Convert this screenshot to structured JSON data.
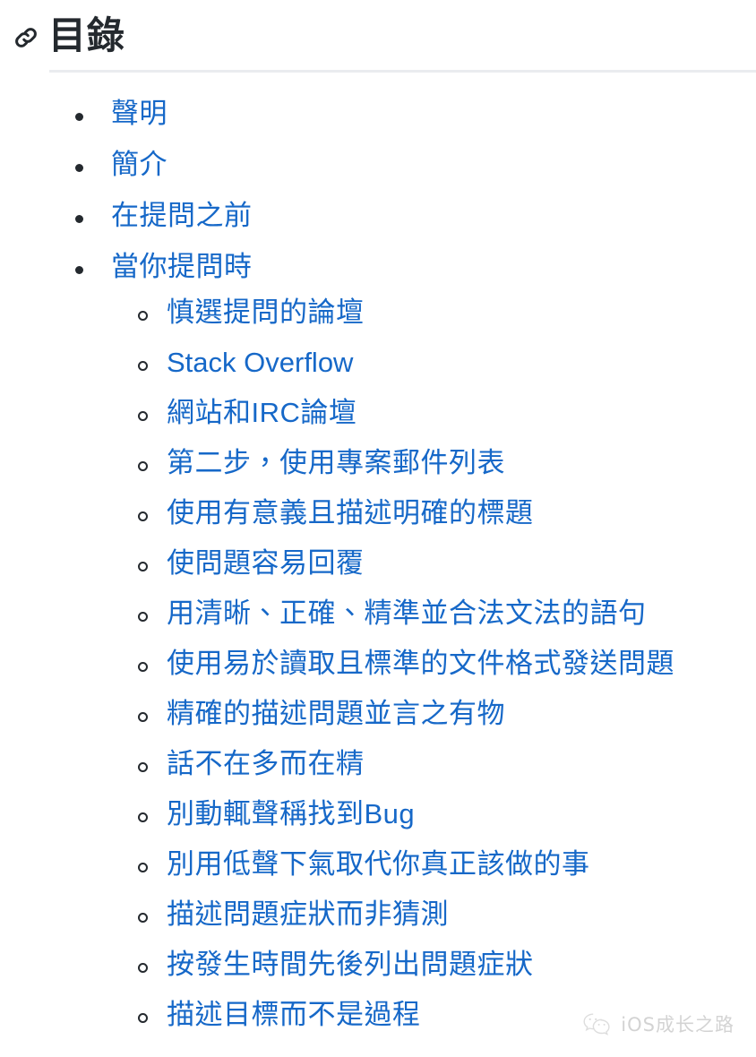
{
  "page": {
    "background_color": "#ffffff",
    "text_color": "#24292e",
    "link_color": "#1668c8",
    "rule_color": "#eaecef"
  },
  "header": {
    "anchor_icon": "link-icon",
    "title": "目錄"
  },
  "toc": {
    "items": [
      {
        "label": "聲明",
        "children": []
      },
      {
        "label": "簡介",
        "children": []
      },
      {
        "label": "在提問之前",
        "children": []
      },
      {
        "label": "當你提問時",
        "children": [
          {
            "label": "慎選提問的論壇"
          },
          {
            "label": "Stack Overflow"
          },
          {
            "label": "網站和IRC論壇"
          },
          {
            "label": "第二步，使用專案郵件列表"
          },
          {
            "label": "使用有意義且描述明確的標題"
          },
          {
            "label": "使問題容易回覆"
          },
          {
            "label": "用清晰、正確、精準並合法文法的語句"
          },
          {
            "label": "使用易於讀取且標準的文件格式發送問題"
          },
          {
            "label": "精確的描述問題並言之有物"
          },
          {
            "label": "話不在多而在精"
          },
          {
            "label": "別動輒聲稱找到Bug"
          },
          {
            "label": "別用低聲下氣取代你真正該做的事"
          },
          {
            "label": "描述問題症狀而非猜測"
          },
          {
            "label": "按發生時間先後列出問題症狀"
          },
          {
            "label": "描述目標而不是過程"
          }
        ]
      }
    ]
  },
  "watermark": {
    "icon": "wechat-icon",
    "text": "iOS成长之路",
    "color": "#b9b9b9"
  }
}
